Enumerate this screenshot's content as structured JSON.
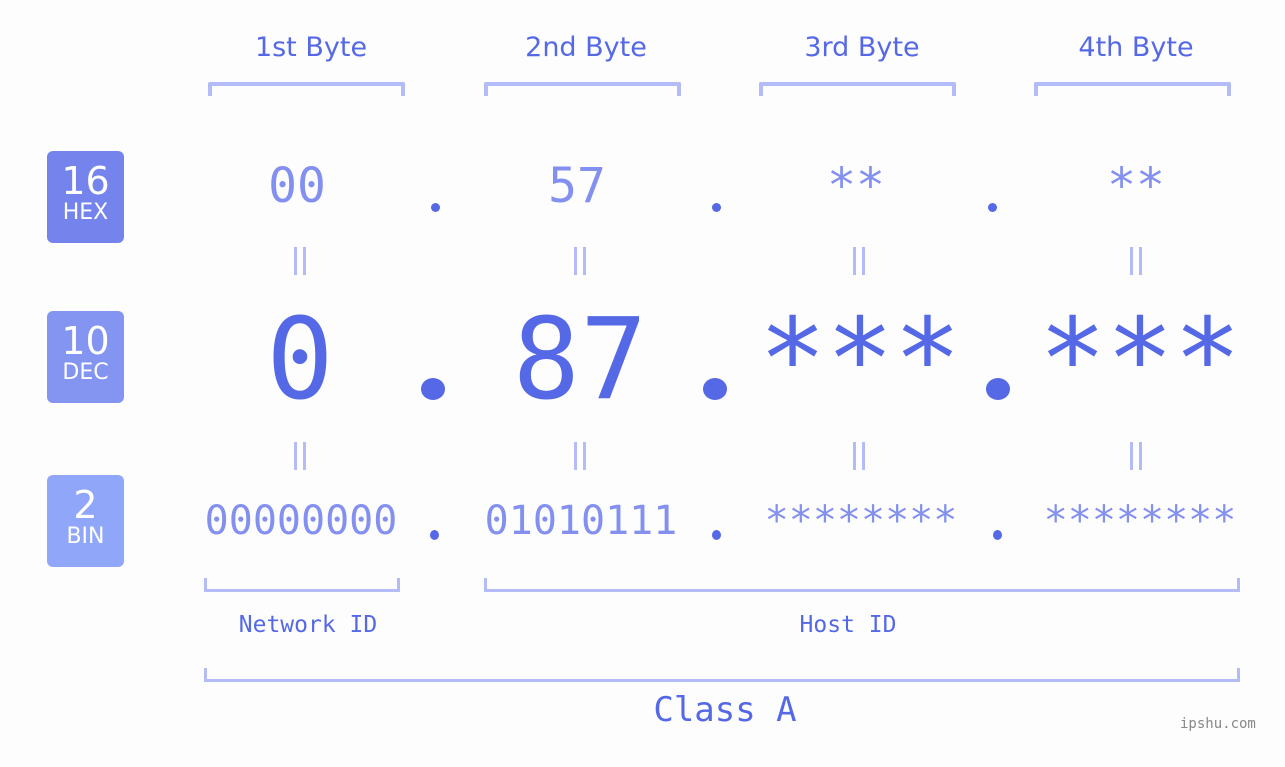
{
  "byte_headers": [
    "1st Byte",
    "2nd Byte",
    "3rd Byte",
    "4th Byte"
  ],
  "rows": {
    "hex": {
      "base": "16",
      "label": "HEX",
      "color": "#7583ec",
      "values": [
        "00",
        "57",
        "**",
        "**"
      ]
    },
    "dec": {
      "base": "10",
      "label": "DEC",
      "color": "#8394f1",
      "values": [
        "0",
        "87",
        "***",
        "***"
      ]
    },
    "bin": {
      "base": "2",
      "label": "BIN",
      "color": "#90a6f8",
      "values": [
        "00000000",
        "01010111",
        "********",
        "********"
      ]
    }
  },
  "separator": ".",
  "network_id_label": "Network ID",
  "host_id_label": "Host ID",
  "class_label": "Class A",
  "watermark": "ipshu.com",
  "colors": {
    "primary": "#5568e6",
    "secondary": "#8390ef",
    "bracket": "#b3bcf7"
  }
}
